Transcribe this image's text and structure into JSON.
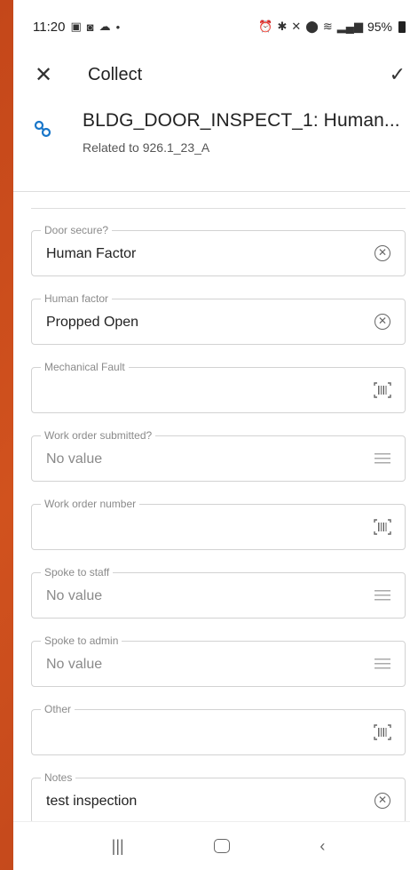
{
  "status": {
    "time": "11:20",
    "battery": "95%"
  },
  "toolbar": {
    "title": "Collect"
  },
  "feature": {
    "title": "BLDG_DOOR_INSPECT_1: Human...",
    "subtitle": "Related to 926.1_23_A"
  },
  "fields": [
    {
      "label": "Door secure?",
      "value": "Human Factor",
      "action": "clear-icon"
    },
    {
      "label": "Human factor",
      "value": "Propped Open",
      "action": "clear-icon"
    },
    {
      "label": "Mechanical Fault",
      "value": "",
      "action": "barcode-icon"
    },
    {
      "label": "Work order submitted?",
      "value": "No value",
      "action": "list-icon"
    },
    {
      "label": "Work order number",
      "value": "",
      "action": "barcode-icon"
    },
    {
      "label": "Spoke to staff",
      "value": "No value",
      "action": "list-icon"
    },
    {
      "label": "Spoke to admin",
      "value": "No value",
      "action": "list-icon"
    },
    {
      "label": "Other",
      "value": "",
      "action": "barcode-icon"
    },
    {
      "label": "Notes",
      "value": "test inspection",
      "action": "clear-icon"
    }
  ],
  "colors": {
    "accent": "#1876c9",
    "background": "#c4471a"
  }
}
